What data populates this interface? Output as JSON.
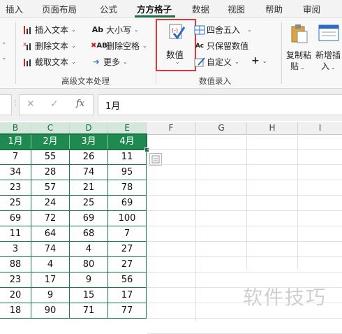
{
  "tabs": [
    "插入",
    "页面布局",
    "公式",
    "方方格子",
    "数据",
    "视图",
    "帮助",
    "审阅"
  ],
  "active_tab": "方方格子",
  "ribbon": {
    "group1": {
      "insert_text": "插入文本",
      "delete_text": "删除文本",
      "extract_text": "截取文本",
      "case": "大小写",
      "delete_space": "删除空格",
      "more": "更多",
      "label": "高级文本处理"
    },
    "group2": {
      "value_button": "数值",
      "round": "四舍五入",
      "keep_value": "只保留数值",
      "custom": "自定义",
      "plus": "+",
      "label": "数值录入"
    },
    "group3": {
      "copy_paste_line1": "复制粘",
      "copy_paste_line2": "贴",
      "new_insert_line1": "新增插",
      "new_insert_line2": "入"
    }
  },
  "formula_bar": {
    "cancel": "✕",
    "confirm": "✓",
    "fx": "fx",
    "value": "1月"
  },
  "columns": [
    "B",
    "C",
    "D",
    "E",
    "F",
    "G",
    "H",
    "I"
  ],
  "table": {
    "header": [
      "1月",
      "2月",
      "3月",
      "4月"
    ],
    "rows": [
      [
        "7",
        "55",
        "26",
        "11"
      ],
      [
        "34",
        "28",
        "74",
        "95"
      ],
      [
        "23",
        "57",
        "21",
        "78"
      ],
      [
        "25",
        "24",
        "25",
        "69"
      ],
      [
        "69",
        "72",
        "69",
        "100"
      ],
      [
        "11",
        "64",
        "68",
        "7"
      ],
      [
        "3",
        "74",
        "4",
        "27"
      ],
      [
        "88",
        "4",
        "80",
        "27"
      ],
      [
        "23",
        "17",
        "9",
        "56"
      ],
      [
        "20",
        "9",
        "15",
        "17"
      ],
      [
        "18",
        "90",
        "71",
        "77"
      ]
    ]
  },
  "watermark": "软件技巧",
  "colors": {
    "accent": "#1e7145",
    "header_fill": "#1e8a4f",
    "highlight_box": "#d9363e"
  }
}
